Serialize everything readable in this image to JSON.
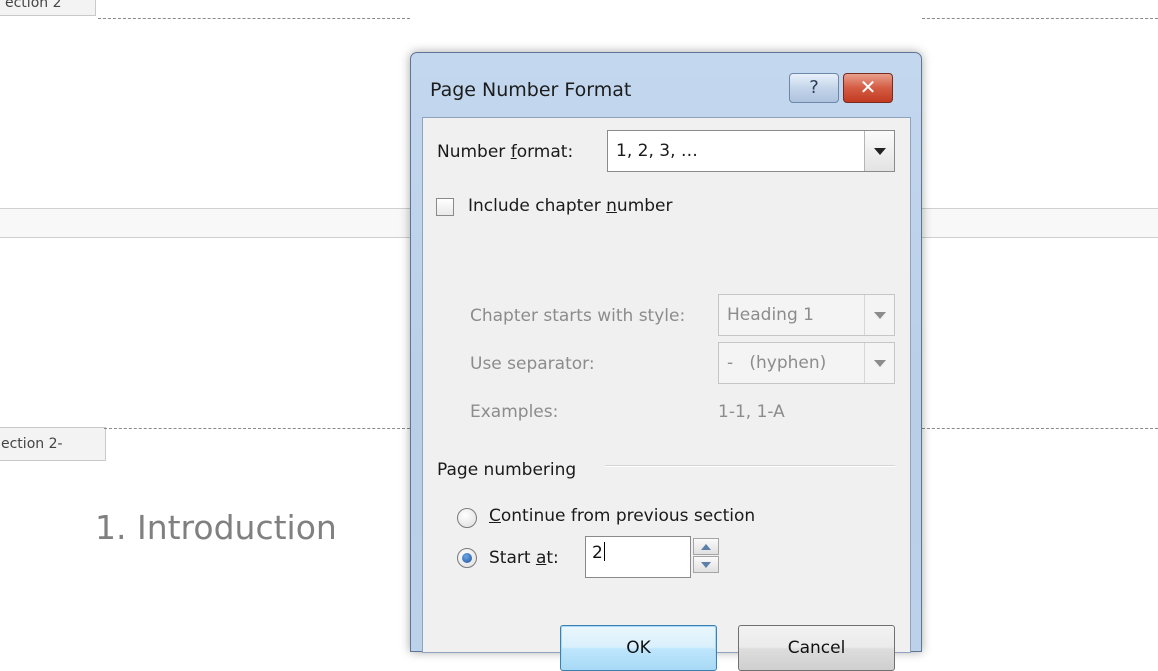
{
  "document": {
    "section_tab_top": "ection 2",
    "section_tab_mid": "ection 2-",
    "heading": "1. Introduction"
  },
  "dialog": {
    "title": "Page Number Format",
    "help_label": "?",
    "close_label": "✕",
    "number_format": {
      "label_pre": "Number ",
      "label_accel": "f",
      "label_post": "ormat:",
      "value": "1, 2, 3, …"
    },
    "include_chapter": {
      "label_pre": "Include chapter ",
      "label_accel": "n",
      "label_post": "umber",
      "checked": false
    },
    "chapter_style": {
      "label": "Chapter starts with style:",
      "value": "Heading 1"
    },
    "separator": {
      "label": "Use separator:",
      "value": "-   (hyphen)"
    },
    "examples": {
      "label": "Examples:",
      "value": "1-1, 1-A"
    },
    "page_numbering": {
      "group_label": "Page numbering",
      "continue": {
        "label_accel": "C",
        "label_post": "ontinue from previous section",
        "selected": false
      },
      "start_at": {
        "label_pre": "Start ",
        "label_accel": "a",
        "label_post": "t:",
        "selected": true,
        "value": "2"
      }
    },
    "ok_label": "OK",
    "cancel_label": "Cancel"
  },
  "colors": {
    "dialog_frame": "#bcd1ea",
    "close_button": "#c13b22",
    "radio_selected": "#1a4f9a",
    "heading_text": "#808080"
  }
}
